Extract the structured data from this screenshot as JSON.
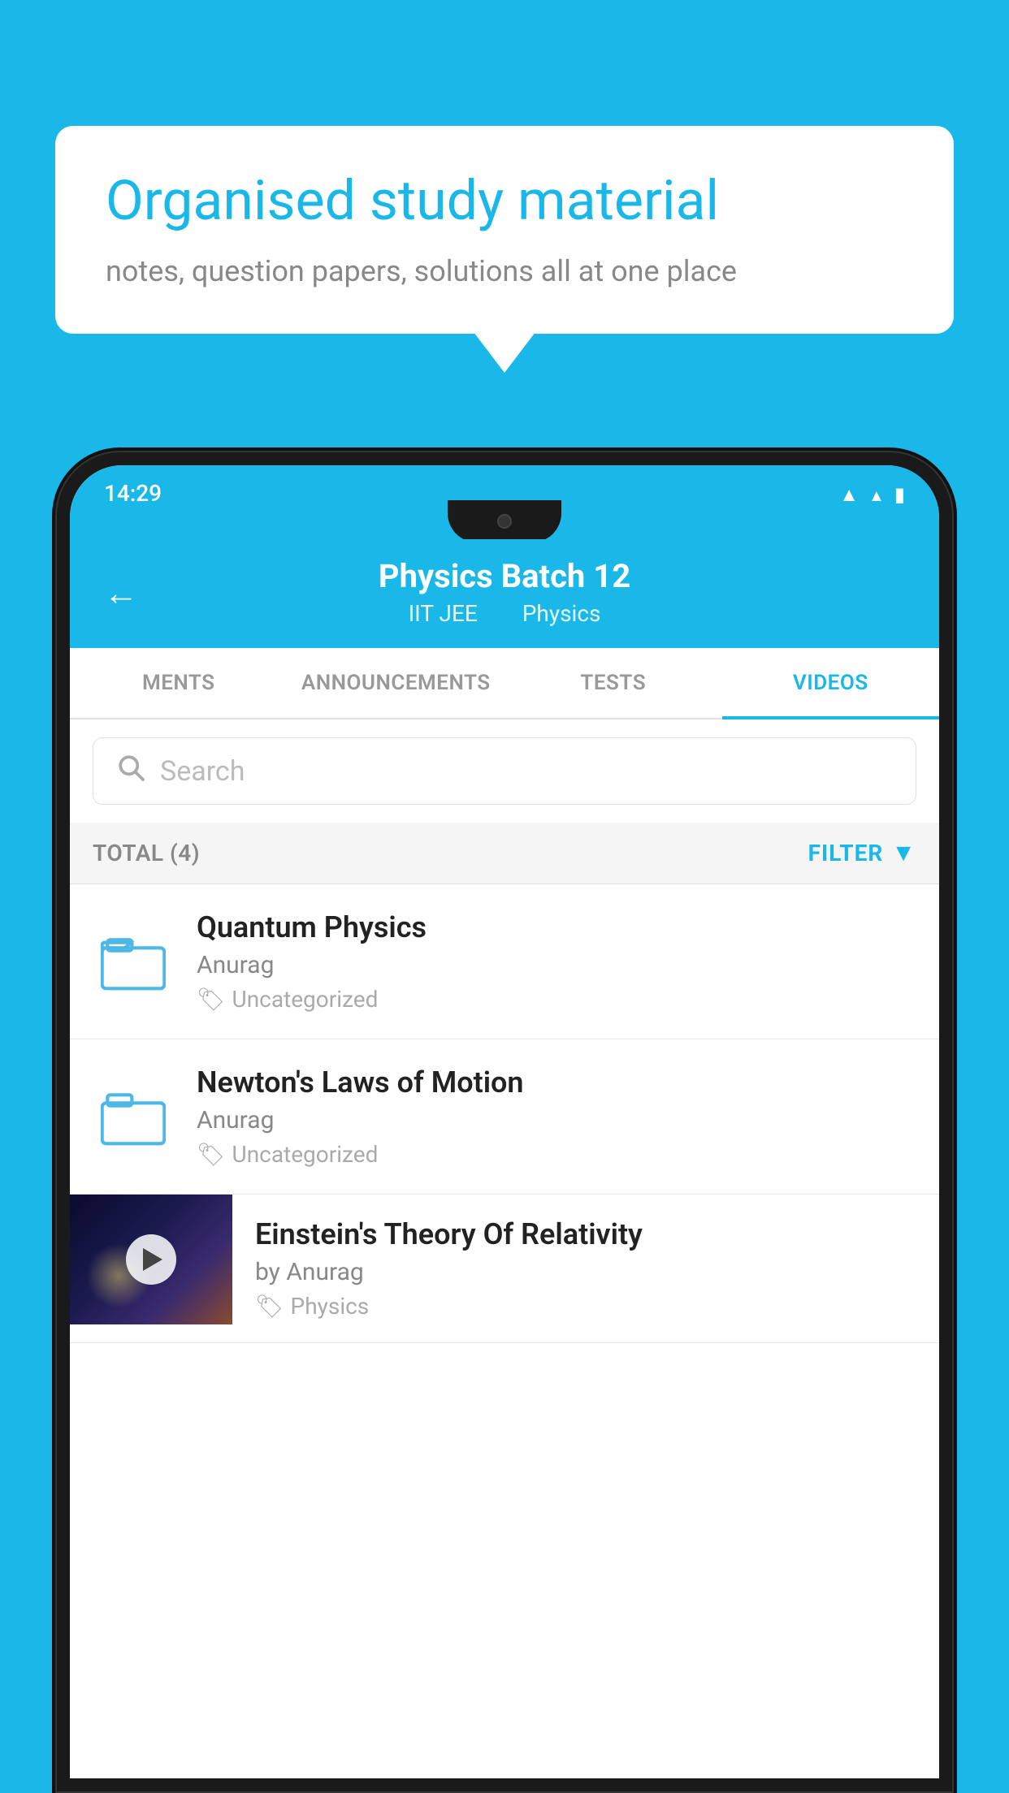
{
  "background": {
    "color": "#1ab8e8"
  },
  "speech_bubble": {
    "title": "Organised study material",
    "subtitle": "notes, question papers, solutions all at one place"
  },
  "phone": {
    "status_bar": {
      "time": "14:29"
    },
    "header": {
      "title": "Physics Batch 12",
      "subtitle_left": "IIT JEE",
      "subtitle_right": "Physics",
      "back_label": "←"
    },
    "tabs": [
      {
        "label": "MENTS",
        "active": false
      },
      {
        "label": "ANNOUNCEMENTS",
        "active": false
      },
      {
        "label": "TESTS",
        "active": false
      },
      {
        "label": "VIDEOS",
        "active": true
      }
    ],
    "search": {
      "placeholder": "Search"
    },
    "filter_row": {
      "total_label": "TOTAL (4)",
      "filter_label": "FILTER"
    },
    "videos": [
      {
        "title": "Quantum Physics",
        "author": "Anurag",
        "tag": "Uncategorized",
        "type": "folder"
      },
      {
        "title": "Newton's Laws of Motion",
        "author": "Anurag",
        "tag": "Uncategorized",
        "type": "folder"
      },
      {
        "title": "Einstein's Theory Of Relativity",
        "author": "by Anurag",
        "tag": "Physics",
        "type": "video"
      }
    ]
  }
}
